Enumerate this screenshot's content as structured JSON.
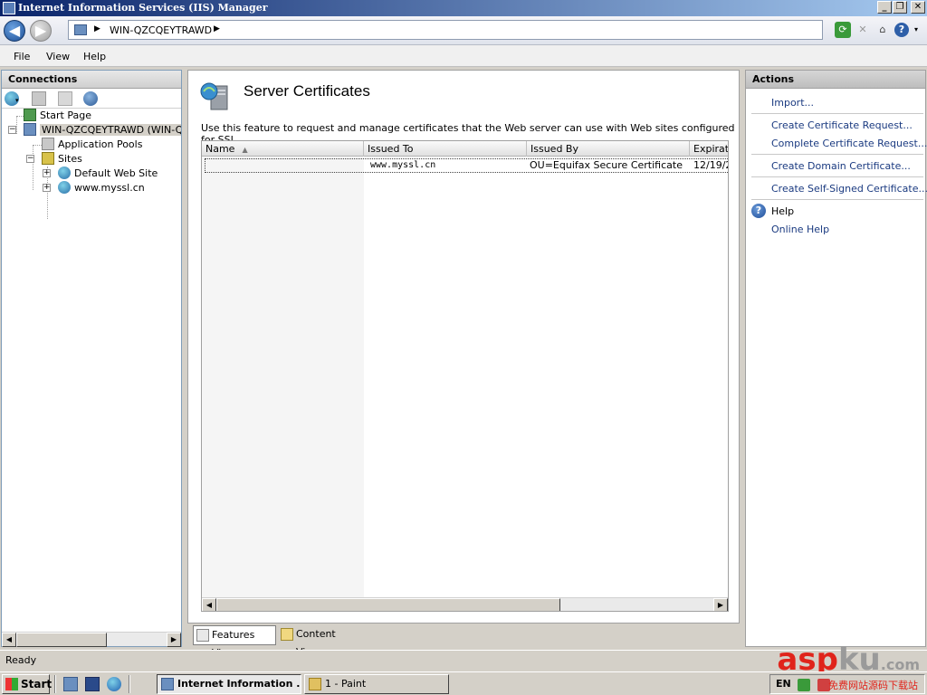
{
  "window": {
    "title": "Internet Information Services (IIS) Manager"
  },
  "address": {
    "crumbs": [
      "WIN-QZCQEYTRAWD"
    ]
  },
  "menu": [
    "File",
    "View",
    "Help"
  ],
  "connections": {
    "title": "Connections",
    "tree": [
      {
        "label": "Start Page",
        "level": 0
      },
      {
        "label": "WIN-QZCQEYTRAWD (WIN-QZC",
        "level": 0,
        "selected": true
      },
      {
        "label": "Application Pools",
        "level": 1
      },
      {
        "label": "Sites",
        "level": 1
      },
      {
        "label": "Default Web Site",
        "level": 2
      },
      {
        "label": "www.myssl.cn",
        "level": 2
      }
    ]
  },
  "feature": {
    "title": "Server Certificates",
    "description": "Use this feature to request and manage certificates that the Web server can use with Web sites configured for SSL.",
    "columns": [
      "Name",
      "Issued To",
      "Issued By",
      "Expirati"
    ],
    "rows": [
      {
        "name": "",
        "issued_to": "www.myssl.cn",
        "issued_by": "OU=Equifax Secure Certificate ...",
        "expiration": "12/19/2"
      }
    ]
  },
  "view_tabs": {
    "features": "Features View",
    "content": "Content View"
  },
  "actions": {
    "title": "Actions",
    "import": "Import...",
    "create_request": "Create Certificate Request...",
    "complete_request": "Complete Certificate Request...",
    "create_domain": "Create Domain Certificate...",
    "create_self_signed": "Create Self-Signed Certificate...",
    "help": "Help",
    "online_help": "Online Help"
  },
  "status": "Ready",
  "taskbar": {
    "start": "Start",
    "tasks": [
      "Internet Information ...",
      "1 - Paint"
    ],
    "language": "EN"
  },
  "watermark": {
    "brand_a": "asp",
    "brand_b": "ku",
    "brand_c": ".com",
    "sub": "免费网站源码下载站"
  }
}
